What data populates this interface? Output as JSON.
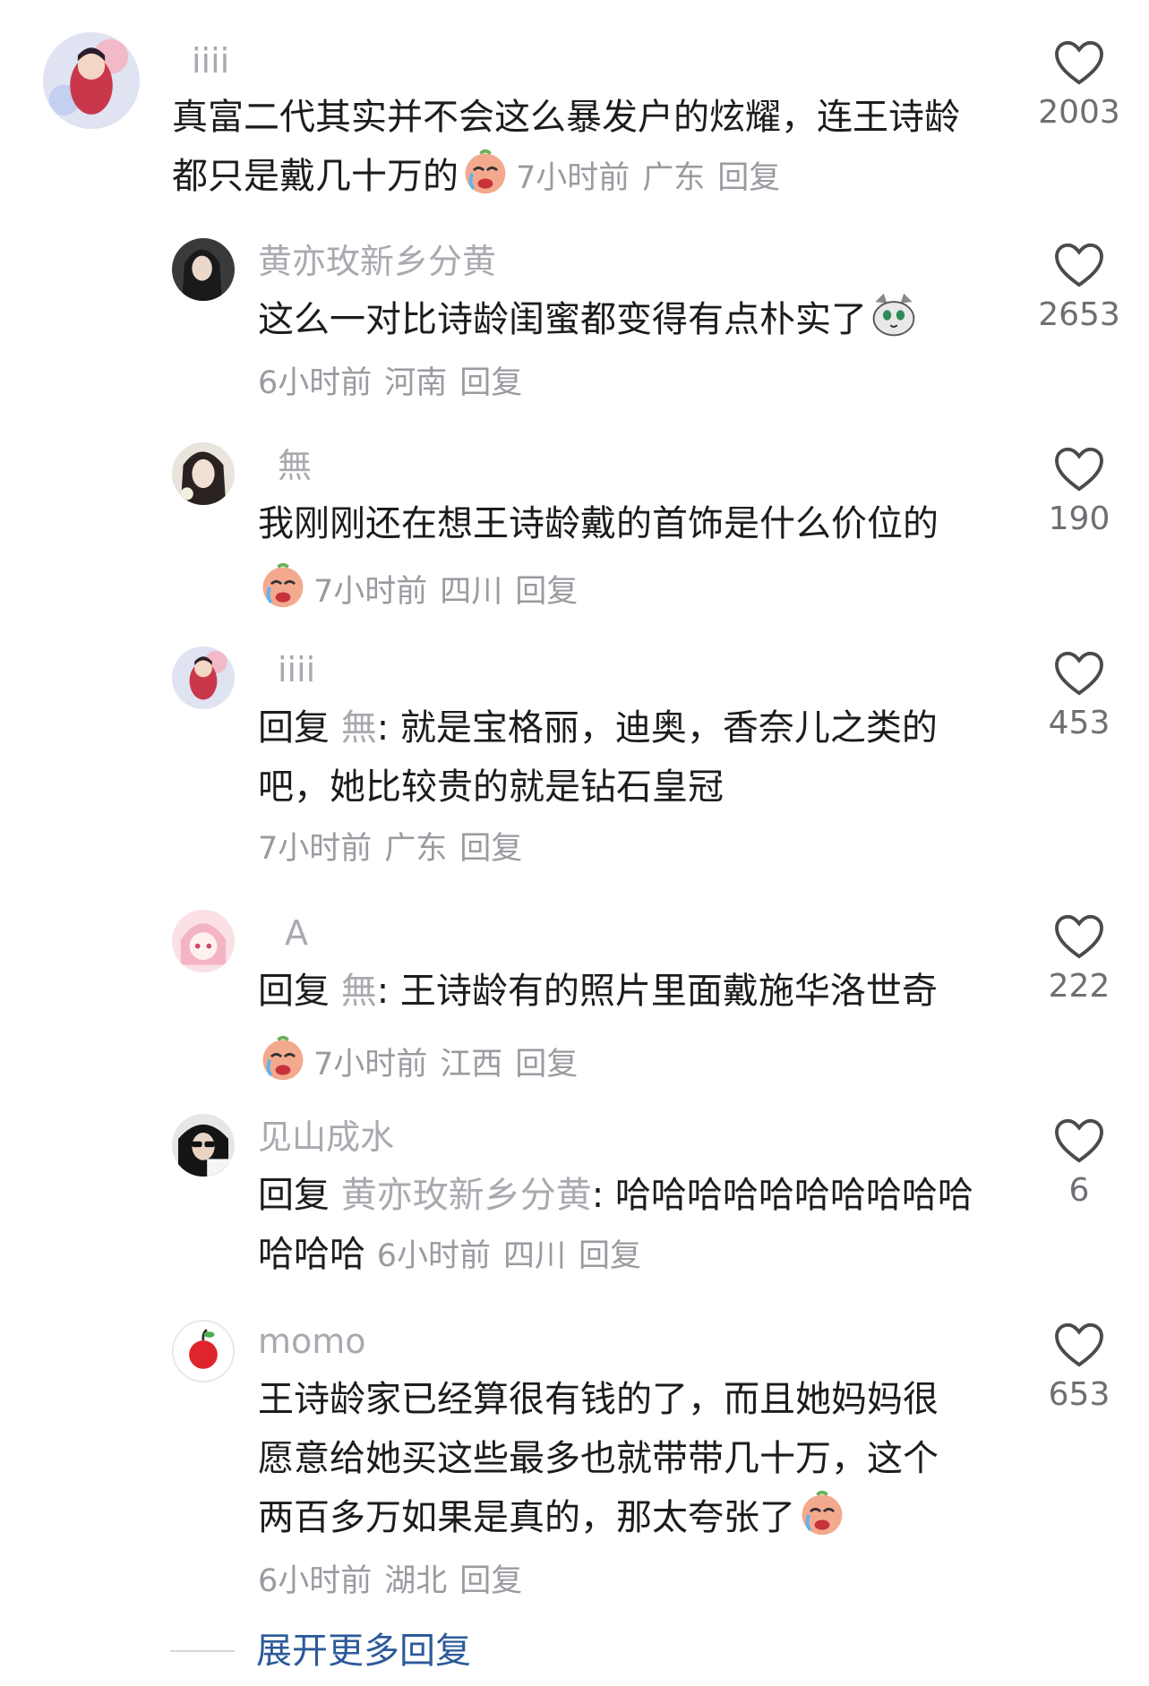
{
  "reply_label": "回复",
  "comments": [
    {
      "user": "iiii",
      "text": "真富二代其实并不会这么暴发户的炫耀，连王诗龄",
      "text2": "都只是戴几十万的",
      "time": "7小时前",
      "location": "广东",
      "likes": "2003"
    },
    {
      "user": "黄亦玫新乡分黄",
      "text": "这么一对比诗龄闺蜜都变得有点朴实了",
      "time": "6小时前",
      "location": "河南",
      "likes": "2653"
    },
    {
      "user": "無",
      "text": "我刚刚还在想王诗龄戴的首饰是什么价位的",
      "time": "7小时前",
      "location": "四川",
      "likes": "190"
    },
    {
      "user": "iiii",
      "reply_prefix": "回复 ",
      "reply_to": "無",
      "text": ": 就是宝格丽，迪奥，香奈儿之类的",
      "text2": "吧，她比较贵的就是钻石皇冠",
      "time": "7小时前",
      "location": "广东",
      "likes": "453"
    },
    {
      "user": "A",
      "reply_prefix": "回复 ",
      "reply_to": "無",
      "text": ": 王诗龄有的照片里面戴施华洛世奇",
      "time": "7小时前",
      "location": "江西",
      "likes": "222"
    },
    {
      "user": "见山成水",
      "reply_prefix": "回复 ",
      "reply_to": "黄亦玫新乡分黄",
      "text": ": 哈哈哈哈哈哈哈哈哈哈",
      "text2": "哈哈哈",
      "time": "6小时前",
      "location": "四川",
      "likes": "6"
    },
    {
      "user": "momo",
      "text": "王诗龄家已经算很有钱的了，而且她妈妈很",
      "text2": "愿意给她买这些最多也就带带几十万，这个",
      "text3": "两百多万如果是真的，那太夸张了",
      "time": "6小时前",
      "location": "湖北",
      "likes": "653"
    }
  ],
  "expand_label": "展开更多回复",
  "icons": {
    "like": "heart-outline-icon",
    "emoji_crying": "crying-face-emoji",
    "emoji_cat": "cat-face-emoji"
  }
}
